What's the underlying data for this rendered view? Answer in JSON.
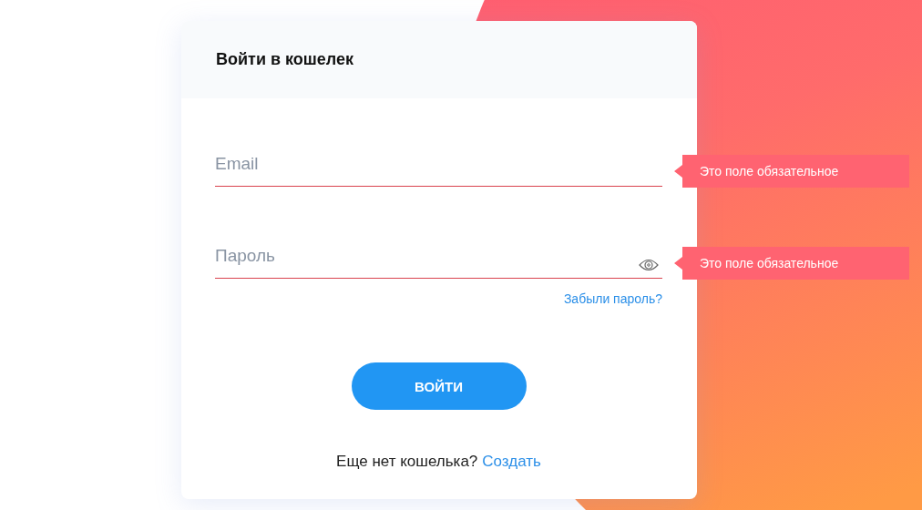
{
  "card": {
    "title": "Войти в кошелек"
  },
  "fields": [
    {
      "kind": "email",
      "placeholder": "Email",
      "error": "Это поле обязательное"
    },
    {
      "kind": "password",
      "placeholder": "Пароль",
      "error": "Это поле обязательное"
    }
  ],
  "forgot_link": "Забыли пароль?",
  "submit_button": "ВОЙТИ",
  "signup": {
    "text": "Еще нет кошелька?",
    "link": "Создать"
  }
}
